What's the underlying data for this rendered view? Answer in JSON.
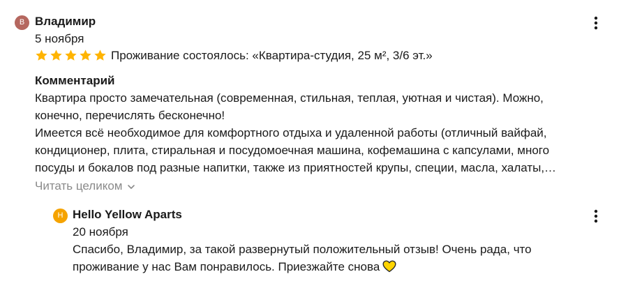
{
  "review": {
    "avatar_letter": "В",
    "avatar_color": "#b5675f",
    "author": "Владимир",
    "date": "5 ноября",
    "rating": 5,
    "star_color": "#ffb400",
    "stay_info": "Проживание состоялось: «Квартира-студия, 25 м², 3/6 эт.»",
    "comment_heading": "Комментарий",
    "comment_lines": [
      "Квартира просто замечательная (современная, стильная, теплая, уютная и чистая). Можно,",
      "конечно, перечислять бесконечно!",
      "Имеется всё необходимое для комфортного отдыха и удаленной работы (отличный вайфай,",
      "кондиционер, плита, стиральная и посудомоечная машина, кофемашина с капсулами, много",
      "посуды и бокалов под разные напитки, также из приятностей крупы, специи, масла, халаты,…"
    ],
    "read_more": "Читать целиком",
    "menu_icon": "more-vertical-icon"
  },
  "reply": {
    "avatar_letter": "H",
    "avatar_color": "#f5a300",
    "author": "Hello Yellow Aparts",
    "date": "20 ноября",
    "text_lines": [
      "Спасибо, Владимир, за такой развернутый положительный отзыв! Очень рада, что",
      "проживание у нас Вам понравилось. Приезжайте снова"
    ],
    "heart_color": "#ffd400",
    "menu_icon": "more-vertical-icon"
  }
}
